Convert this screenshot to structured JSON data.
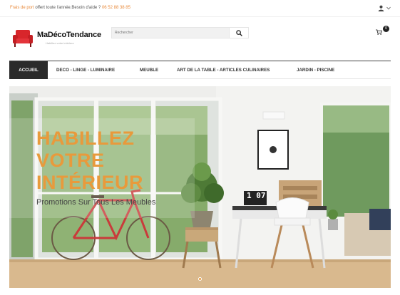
{
  "topbar": {
    "message_orange": "Frais de port",
    "message_main": " offert toute l'année.Besoin d'aide ? ",
    "phone": "06 52 88 38 85",
    "user_icon": "user-icon",
    "chevron_icon": "chevron-down-icon"
  },
  "header": {
    "logo_icon": "red-sofa-logo",
    "brand": "MaDécoTendance",
    "tagline": "Habillez votre intérieur",
    "search_placeholder": "Rechercher",
    "search_icon": "search-icon",
    "cart_icon": "cart-icon",
    "cart_count": "0"
  },
  "nav": {
    "items": [
      {
        "label": "ACCUEIL",
        "active": true
      },
      {
        "label": "DECO - LINGE - LUMINAIRE"
      },
      {
        "label": "MEUBLE"
      },
      {
        "label": "ART DE LA TABLE - ARTICLES CULINAIRES"
      },
      {
        "label": "JARDIN - PISCINE"
      }
    ]
  },
  "hero": {
    "title": "HABILLEZ\nVOTRE\nINTÉRIEUR",
    "subtitle": "Promotions Sur Tous Les Meubles",
    "clock": "1 07",
    "accent_color": "#e89a3c",
    "slide_dots": 1
  }
}
